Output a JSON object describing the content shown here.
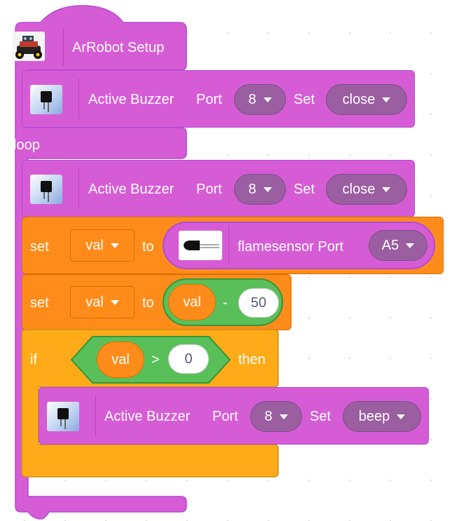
{
  "setup_block": {
    "label": "ArRobot Setup",
    "icon": "robot-car-icon"
  },
  "loop_label": "loop",
  "buzzer_blocks": [
    {
      "label": "Active Buzzer",
      "port_label": "Port",
      "port_value": "8",
      "set_label": "Set",
      "set_value": "close",
      "icon": "buzzer-icon"
    },
    {
      "label": "Active Buzzer",
      "port_label": "Port",
      "port_value": "8",
      "set_label": "Set",
      "set_value": "close",
      "icon": "buzzer-icon"
    },
    {
      "label": "Active Buzzer",
      "port_label": "Port",
      "port_value": "8",
      "set_label": "Set",
      "set_value": "beep",
      "icon": "buzzer-icon"
    }
  ],
  "set_block_1": {
    "set_label": "set",
    "var_value": "val",
    "to_label": "to",
    "reporter": {
      "label": "flamesensor Port",
      "port_value": "A5",
      "icon": "flame-sensor-icon"
    }
  },
  "set_block_2": {
    "set_label": "set",
    "var_value": "val",
    "to_label": "to",
    "operator": {
      "left": "val",
      "op": "-",
      "right": "50"
    }
  },
  "if_block": {
    "if_label": "if",
    "condition": {
      "left": "val",
      "op": ">",
      "right": "0"
    },
    "then_label": "then"
  },
  "colors": {
    "magenta": "#d65cd6",
    "purple_dropdown": "#9a5ea1",
    "orange_variable": "#ff8c1a",
    "green_operator": "#59c059",
    "amber_control": "#ffab19"
  }
}
